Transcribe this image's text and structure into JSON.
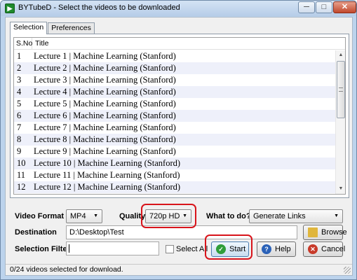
{
  "window": {
    "title": "BYTubeD - Select the videos to be downloaded",
    "controls": {
      "minimize": "─",
      "maximize": "□",
      "close": "✕"
    }
  },
  "tabs": [
    {
      "label": "Selection",
      "active": true
    },
    {
      "label": "Preferences",
      "active": false
    }
  ],
  "list": {
    "columns": {
      "sno": "S.No",
      "title": "Title"
    },
    "rows": [
      {
        "sno": "1",
        "title": "Lecture 1 | Machine Learning (Stanford)"
      },
      {
        "sno": "2",
        "title": "Lecture 2 | Machine Learning (Stanford)"
      },
      {
        "sno": "3",
        "title": "Lecture 3 | Machine Learning (Stanford)"
      },
      {
        "sno": "4",
        "title": "Lecture 4 | Machine Learning (Stanford)"
      },
      {
        "sno": "5",
        "title": "Lecture 5 | Machine Learning (Stanford)"
      },
      {
        "sno": "6",
        "title": "Lecture 6 | Machine Learning (Stanford)"
      },
      {
        "sno": "7",
        "title": "Lecture 7 | Machine Learning (Stanford)"
      },
      {
        "sno": "8",
        "title": "Lecture 8 | Machine Learning (Stanford)"
      },
      {
        "sno": "9",
        "title": "Lecture 9 | Machine Learning (Stanford)"
      },
      {
        "sno": "10",
        "title": "Lecture 10 | Machine Learning (Stanford)"
      },
      {
        "sno": "11",
        "title": "Lecture 11 | Machine Learning (Stanford)"
      },
      {
        "sno": "12",
        "title": "Lecture 12 | Machine Learning (Stanford)"
      }
    ]
  },
  "options": {
    "video_format_label": "Video Format",
    "video_format_value": "MP4",
    "quality_label": "Quality",
    "quality_value": "720p HD",
    "what_to_do_label": "What to do?",
    "what_to_do_value": "Generate Links",
    "destination_label": "Destination",
    "destination_value": "D:\\Desktop\\Test",
    "browse_label": "Browse",
    "selection_filter_label": "Selection Filter",
    "selection_filter_value": "",
    "select_all_label": "Select All",
    "start_label": "Start",
    "help_label": "Help",
    "cancel_label": "Cancel"
  },
  "status": {
    "text": "0/24 videos selected for download."
  },
  "icons": {
    "app": "app-icon",
    "start": "check-icon",
    "help": "question-icon",
    "cancel": "cancel-icon",
    "browse": "folder-icon"
  },
  "colors": {
    "highlight": "#d8141b",
    "row_alt": "#eef0fa",
    "frame": "#bcd3ec"
  }
}
